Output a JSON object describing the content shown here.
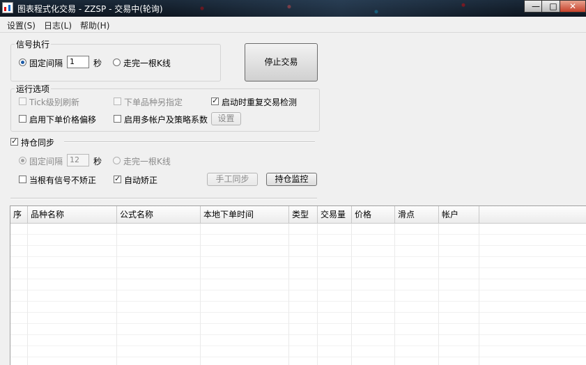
{
  "window": {
    "title": "图表程式化交易 - ZZSP - 交易中(轮询)",
    "controls": [
      "—",
      "□",
      "✕"
    ]
  },
  "menu": [
    "设置(S)",
    "日志(L)",
    "帮助(H)"
  ],
  "signal": {
    "group_label": "信号执行",
    "fixed_interval_label": "固定间隔",
    "interval_value": "1",
    "seconds_unit": "秒",
    "bar_complete_label": "走完一根K线",
    "mode": "fixed_interval"
  },
  "stop_button": "停止交易",
  "run_options": {
    "group_label": "运行选项",
    "tick_refresh": {
      "label": "Tick级别刷新",
      "checked": false,
      "enabled": false
    },
    "instrument_specify": {
      "label": "下单品种另指定",
      "checked": false,
      "enabled": false
    },
    "repeat_check": {
      "label": "启动时重复交易检测",
      "checked": true,
      "enabled": true
    },
    "price_offset": {
      "label": "启用下单价格偏移",
      "checked": false,
      "enabled": true
    },
    "multi_account": {
      "label": "启用多帐户及策略系数",
      "checked": false,
      "enabled": true
    },
    "settings_button": "设置"
  },
  "position_sync": {
    "label": "持仓同步",
    "checked": true,
    "fixed_interval_label": "固定间隔",
    "interval_value": "12",
    "seconds_unit": "秒",
    "bar_complete_label": "走完一根K线",
    "no_correct_label": "当根有信号不矫正",
    "no_correct_checked": false,
    "auto_correct_label": "自动矫正",
    "auto_correct_checked": true,
    "manual_sync_button": "手工同步",
    "monitor_button": "持仓监控"
  },
  "table": {
    "columns": [
      "序",
      "品种名称",
      "公式名称",
      "本地下单时间",
      "类型",
      "交易量",
      "价格",
      "滑点",
      "帐户"
    ],
    "rows": []
  }
}
